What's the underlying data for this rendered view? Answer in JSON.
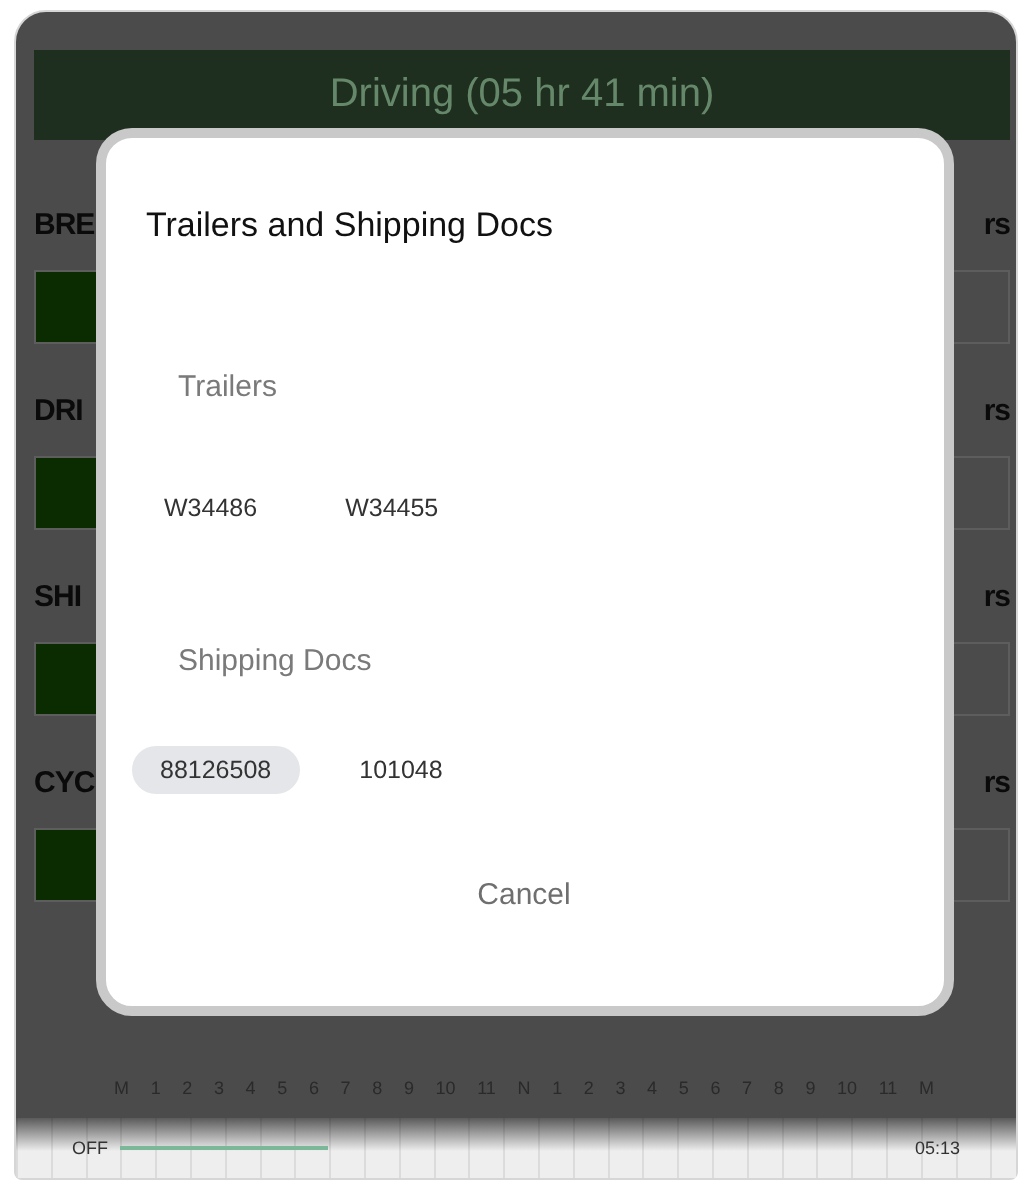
{
  "background": {
    "status_header": "Driving (05 hr 41 min)",
    "rows": [
      {
        "label": "BRE",
        "right_text": "rs"
      },
      {
        "label": "DRI",
        "right_text": "rs"
      },
      {
        "label": "SHI",
        "right_text": "rs"
      },
      {
        "label": "CYC",
        "right_text": "rs"
      }
    ],
    "hours": [
      "M",
      "1",
      "2",
      "3",
      "4",
      "5",
      "6",
      "7",
      "8",
      "9",
      "10",
      "11",
      "N",
      "1",
      "2",
      "3",
      "4",
      "5",
      "6",
      "7",
      "8",
      "9",
      "10",
      "11",
      "M"
    ],
    "timeline": {
      "status_label": "OFF",
      "total": "05:13"
    }
  },
  "dialog": {
    "title": "Trailers and Shipping Docs",
    "sections": [
      {
        "heading": "Trailers",
        "items": [
          {
            "label": "W34486",
            "selected": false
          },
          {
            "label": "W34455",
            "selected": false
          }
        ]
      },
      {
        "heading": "Shipping Docs",
        "items": [
          {
            "label": "88126508",
            "selected": true
          },
          {
            "label": "101048",
            "selected": false
          }
        ]
      }
    ],
    "cancel": "Cancel"
  }
}
